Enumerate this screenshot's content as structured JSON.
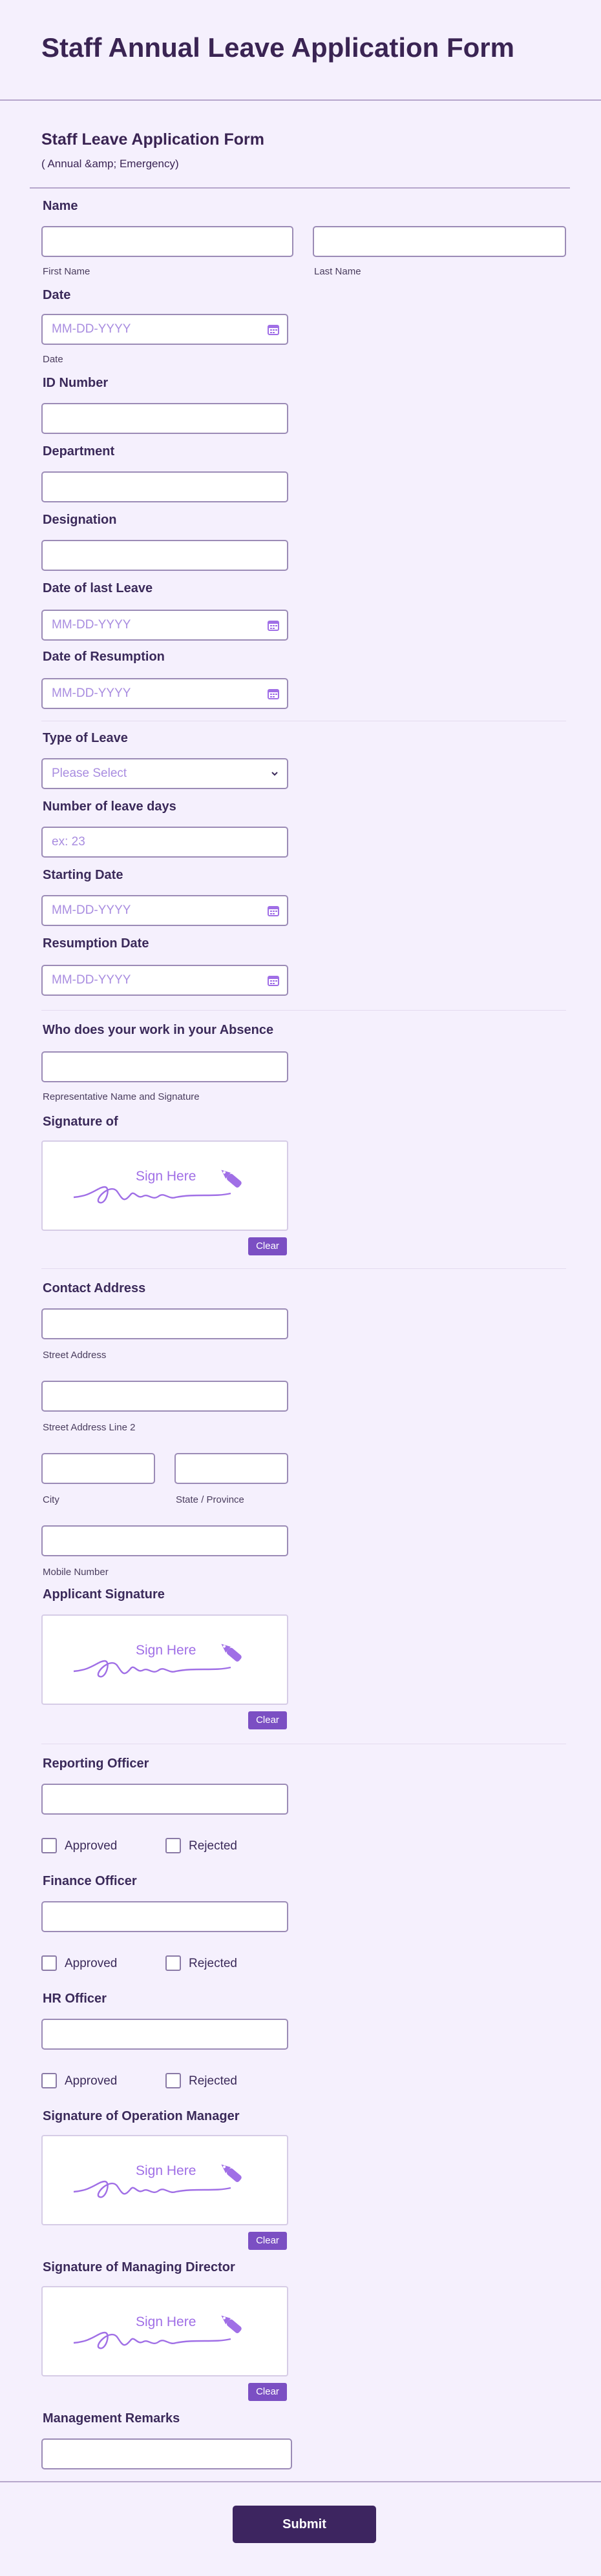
{
  "header": {
    "title": "Staff Annual Leave Application Form"
  },
  "section": {
    "title": "Staff Leave Application Form",
    "subtitle": "( Annual &amp; Emergency)"
  },
  "fields": {
    "name": {
      "label": "Name",
      "first_sub": "First Name",
      "last_sub": "Last Name"
    },
    "date": {
      "label": "Date",
      "placeholder": "MM-DD-YYYY",
      "sub": "Date"
    },
    "id_number": {
      "label": "ID Number"
    },
    "department": {
      "label": "Department"
    },
    "designation": {
      "label": "Designation"
    },
    "last_leave": {
      "label": "Date of last Leave",
      "placeholder": "MM-DD-YYYY"
    },
    "resumption_prev": {
      "label": "Date of Resumption",
      "placeholder": "MM-DD-YYYY"
    },
    "leave_type": {
      "label": "Type of Leave",
      "placeholder": "Please Select"
    },
    "leave_days": {
      "label": "Number of leave days",
      "placeholder": "ex: 23"
    },
    "starting_date": {
      "label": "Starting Date",
      "placeholder": "MM-DD-YYYY"
    },
    "resumption_date": {
      "label": "Resumption Date",
      "placeholder": "MM-DD-YYYY"
    },
    "absence_cover": {
      "label": "Who does your work in your Absence",
      "sub": "Representative Name and Signature"
    },
    "signature_of": {
      "label": "Signature of"
    },
    "contact_address": {
      "label": "Contact Address",
      "street_sub": "Street Address",
      "street2_sub": "Street Address Line 2",
      "city_sub": "City",
      "state_sub": "State / Province"
    },
    "mobile": {
      "sub": "Mobile Number"
    },
    "applicant_sig": {
      "label": "Applicant Signature"
    },
    "reporting_officer": {
      "label": "Reporting Officer"
    },
    "finance_officer": {
      "label": "Finance Officer"
    },
    "hr_officer": {
      "label": "HR Officer"
    },
    "op_manager_sig": {
      "label": "Signature of Operation Manager"
    },
    "md_sig": {
      "label": "Signature of Managing Director"
    },
    "remarks": {
      "label": "Management Remarks"
    }
  },
  "common": {
    "sign_here": "Sign Here",
    "clear": "Clear",
    "approved": "Approved",
    "rejected": "Rejected"
  },
  "submit": {
    "label": "Submit"
  },
  "colors": {
    "accent": "#7b4fc3",
    "dark": "#3d2560",
    "background": "#f5f0fd"
  }
}
